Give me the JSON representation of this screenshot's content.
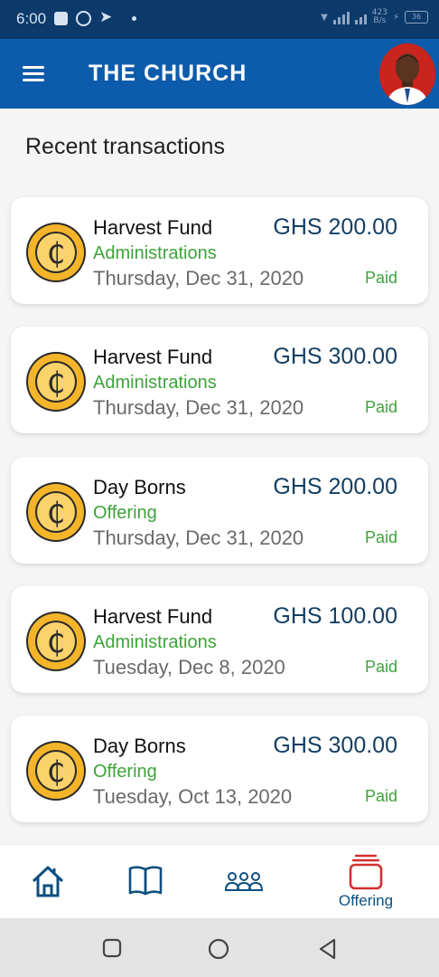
{
  "status_bar": {
    "time": "6:00",
    "speed_top": "423",
    "speed_bottom": "B/s",
    "battery": "36"
  },
  "app_bar": {
    "title": "THE CHURCH"
  },
  "main": {
    "section_title": "Recent transactions",
    "transactions": [
      {
        "title": "Harvest Fund",
        "amount": "GHS 200.00",
        "category": "Administrations",
        "date": "Thursday, Dec 31, 2020",
        "status": "Paid"
      },
      {
        "title": "Harvest Fund",
        "amount": "GHS 300.00",
        "category": "Administrations",
        "date": "Thursday, Dec 31, 2020",
        "status": "Paid"
      },
      {
        "title": "Day Borns",
        "amount": "GHS 200.00",
        "category": "Offering",
        "date": "Thursday, Dec 31, 2020",
        "status": "Paid"
      },
      {
        "title": "Harvest Fund",
        "amount": "GHS 100.00",
        "category": "Administrations",
        "date": "Tuesday, Dec 8, 2020",
        "status": "Paid"
      },
      {
        "title": "Day Borns",
        "amount": "GHS 300.00",
        "category": "Offering",
        "date": "Tuesday, Oct 13, 2020",
        "status": "Paid"
      }
    ]
  },
  "bottom_nav": {
    "items": [
      {
        "icon": "home-icon",
        "label": ""
      },
      {
        "icon": "book-icon",
        "label": ""
      },
      {
        "icon": "people-icon",
        "label": ""
      },
      {
        "icon": "offering-icon",
        "label": "Offering"
      }
    ],
    "active_color": "#d32f2f",
    "inactive_color": "#0d4f7f"
  },
  "colors": {
    "app_bar": "#0d5cab",
    "status_bar": "#0b3a6b",
    "amount": "#123e63",
    "accent_green": "#3da33a",
    "coin_gold": "#f5b52a"
  }
}
